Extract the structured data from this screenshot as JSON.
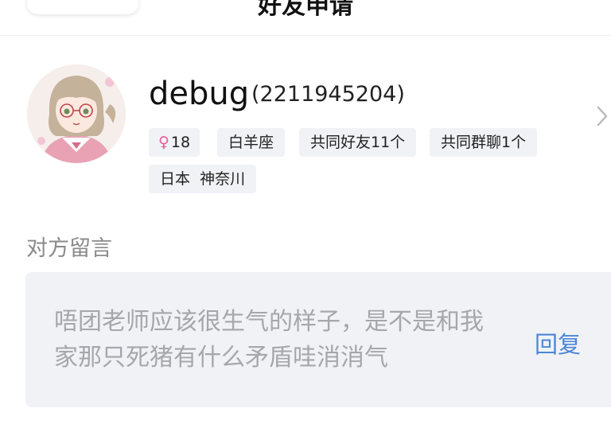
{
  "header": {
    "title": "好友申请"
  },
  "profile": {
    "name": "debug",
    "uid": "(2211945204)",
    "tags": {
      "gender_age": "18",
      "zodiac": "白羊座",
      "mutual_friends": "共同好友11个",
      "mutual_groups": "共同群聊1个",
      "location": "日本  神奈川"
    }
  },
  "message": {
    "section_label": "对方留言",
    "text": "唔团老师应该很生气的样子，是不是和我家那只死猪有什么矛盾哇消消气",
    "reply_label": "回复"
  },
  "colors": {
    "link": "#4a86d6",
    "female": "#ea5a9a",
    "tag_bg": "#f0f2f6",
    "message_bg": "#f1f2f6"
  }
}
